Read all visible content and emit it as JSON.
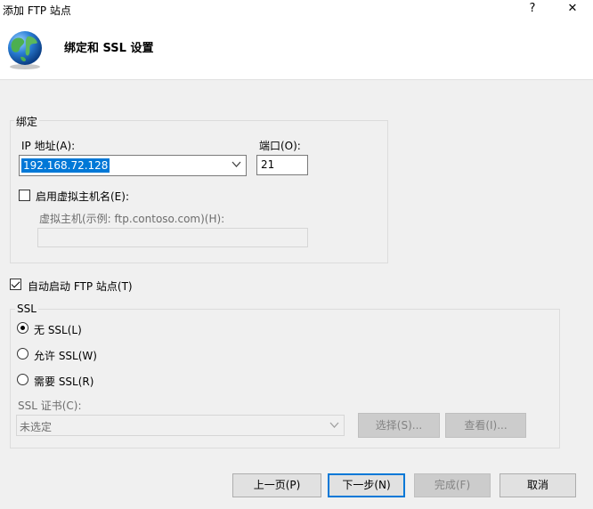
{
  "window": {
    "title": "添加 FTP 站点",
    "help_label": "?",
    "close_label": "✕"
  },
  "header": {
    "title": "绑定和 SSL 设置",
    "icon": "globe-icon"
  },
  "binding": {
    "legend": "绑定",
    "ip_label": "IP 地址(A):",
    "ip_value": "192.168.72.128",
    "port_label": "端口(O):",
    "port_value": "21",
    "virtual_host_checkbox_label": "启用虚拟主机名(E):",
    "virtual_host_checked": false,
    "virtual_host_label": "虚拟主机(示例: ftp.contoso.com)(H):",
    "virtual_host_value": ""
  },
  "autostart": {
    "label": "自动启动 FTP 站点(T)",
    "checked": true
  },
  "ssl": {
    "legend": "SSL",
    "options": [
      {
        "label": "无 SSL(L)",
        "selected": true
      },
      {
        "label": "允许 SSL(W)",
        "selected": false
      },
      {
        "label": "需要 SSL(R)",
        "selected": false
      }
    ],
    "cert_label": "SSL 证书(C):",
    "cert_value": "未选定",
    "select_button": "选择(S)...",
    "view_button": "查看(I)..."
  },
  "footer": {
    "prev_button": "上一页(P)",
    "next_button": "下一步(N)",
    "finish_button": "完成(F)",
    "cancel_button": "取消"
  },
  "colors": {
    "accent": "#0078d7",
    "background": "#f0f0f0"
  }
}
